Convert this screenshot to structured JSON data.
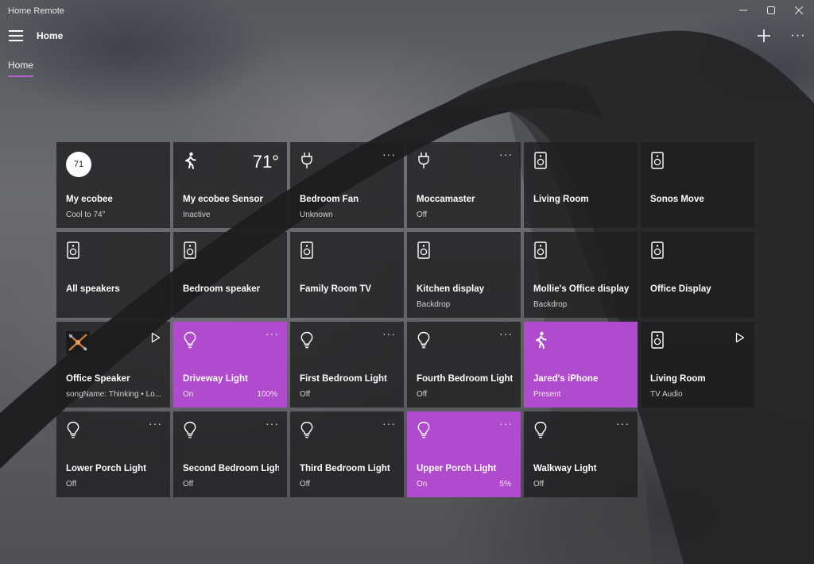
{
  "window": {
    "title": "Home Remote"
  },
  "header": {
    "title": "Home"
  },
  "tabs": [
    {
      "label": "Home"
    }
  ],
  "colors": {
    "accent": "#b14bcd",
    "tile_bg": "#1e1e20",
    "underline": "#b561d2"
  },
  "tiles": [
    {
      "name": "My ecobee",
      "status": "Cool to 74°",
      "icon": "thermostat-badge",
      "badge": "71",
      "state": "off"
    },
    {
      "name": "My ecobee Sensor",
      "status": "Inactive",
      "icon": "motion-icon",
      "temp": "71°",
      "state": "off"
    },
    {
      "name": "Bedroom Fan",
      "status": "Unknown",
      "icon": "plug-icon",
      "more": "···",
      "state": "off"
    },
    {
      "name": "Moccamaster",
      "status": "Off",
      "icon": "plug-icon",
      "more": "···",
      "state": "off"
    },
    {
      "name": "Living Room",
      "status": "",
      "icon": "speaker-icon",
      "state": "off"
    },
    {
      "name": "Sonos Move",
      "status": "",
      "icon": "speaker-icon",
      "state": "off"
    },
    {
      "name": "All speakers",
      "status": "",
      "icon": "speaker-icon",
      "state": "off"
    },
    {
      "name": "Bedroom speaker",
      "status": "",
      "icon": "speaker-icon",
      "state": "off"
    },
    {
      "name": "Family Room TV",
      "status": "",
      "icon": "speaker-icon",
      "state": "off"
    },
    {
      "name": "Kitchen display",
      "status": "Backdrop",
      "icon": "speaker-icon",
      "state": "off"
    },
    {
      "name": "Mollie's Office display",
      "status": "Backdrop",
      "icon": "speaker-icon",
      "state": "off"
    },
    {
      "name": "Office Display",
      "status": "",
      "icon": "speaker-icon",
      "state": "off"
    },
    {
      "name": "Office Speaker",
      "status": "songName: Thinking • Lo...",
      "icon": "album-art",
      "play": true,
      "state": "off"
    },
    {
      "name": "Driveway Light",
      "status": "On",
      "level": "100%",
      "icon": "bulb-icon",
      "more": "···",
      "state": "on"
    },
    {
      "name": "First Bedroom Light",
      "status": "Off",
      "icon": "bulb-icon",
      "more": "···",
      "state": "off"
    },
    {
      "name": "Fourth Bedroom Light",
      "status": "Off",
      "icon": "bulb-icon",
      "more": "···",
      "state": "off"
    },
    {
      "name": "Jared's iPhone",
      "status": "Present",
      "icon": "motion-icon",
      "state": "on"
    },
    {
      "name": "Living Room",
      "status": "TV Audio",
      "icon": "speaker-icon",
      "play": true,
      "state": "off"
    },
    {
      "name": "Lower Porch Light",
      "status": "Off",
      "icon": "bulb-icon",
      "more": "···",
      "state": "off"
    },
    {
      "name": "Second Bedroom Light",
      "status": "Off",
      "icon": "bulb-icon",
      "more": "···",
      "state": "off"
    },
    {
      "name": "Third Bedroom Light",
      "status": "Off",
      "icon": "bulb-icon",
      "more": "···",
      "state": "off"
    },
    {
      "name": "Upper Porch Light",
      "status": "On",
      "level": "5%",
      "icon": "bulb-icon",
      "more": "···",
      "state": "on"
    },
    {
      "name": "Walkway Light",
      "status": "Off",
      "icon": "bulb-icon",
      "more": "···",
      "state": "off"
    }
  ]
}
